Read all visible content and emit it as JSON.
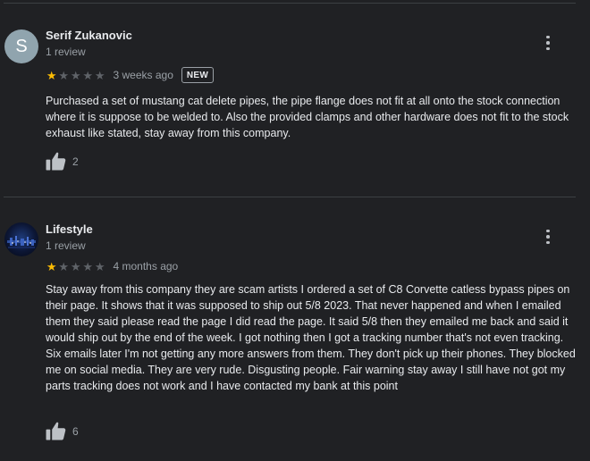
{
  "reviews": [
    {
      "author": "Serif Zukanovic",
      "avatar_letter": "S",
      "review_count": "1 review",
      "rating": 1,
      "max_rating": 5,
      "time": "3 weeks ago",
      "badge": "NEW",
      "text": "Purchased a set of mustang cat delete pipes, the pipe flange does not fit at all onto the stock connection where it is suppose to be welded to. Also the provided clamps and other hardware does not fit to the stock exhaust like stated, stay away from this company.",
      "likes": "2",
      "icons": {
        "more": "more-vert-icon",
        "like": "thumb-up-icon"
      }
    },
    {
      "author": "Lifestyle",
      "avatar_letter": "",
      "review_count": "1 review",
      "rating": 1,
      "max_rating": 5,
      "time": "4 months ago",
      "badge": "",
      "text": "Stay away from this company they are scam artists I ordered a set of C8 Corvette catless bypass pipes on their page. It shows that it was supposed to ship out 5/8  2023. That never happened and when I emailed them they said please read the page I did read the page. It said 5/8 then they emailed me back and said it would ship out by the end of the week. I got nothing then I got a tracking number that's not even tracking. Six emails later I'm not getting any more answers from them. They don't pick up their phones. They blocked me on social media. They are very rude. Disgusting people. Fair warning stay away I still have not got my parts tracking does not work and I have contacted my bank at this point",
      "likes": "6",
      "icons": {
        "more": "more-vert-icon",
        "like": "thumb-up-icon"
      }
    }
  ],
  "colors": {
    "background": "#202124",
    "star_filled": "#fbbc04",
    "star_empty": "#5f6368",
    "secondary_text": "#9aa0a6",
    "avatar_s": "#90a4ae"
  }
}
